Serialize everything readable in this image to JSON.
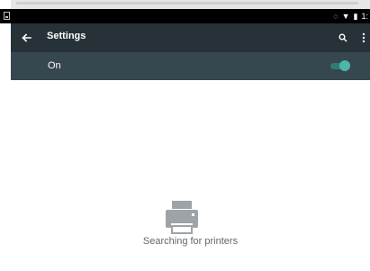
{
  "status_bar": {
    "time": "1:"
  },
  "app_bar": {
    "title": "Settings"
  },
  "switch_bar": {
    "label": "On",
    "enabled": true,
    "accent": "#4db6ac"
  },
  "empty_state": {
    "message": "Searching for printers",
    "icon": "printer-icon"
  },
  "colors": {
    "app_bar": "#263238",
    "switch_bar": "#37474f",
    "status_bar": "#000000"
  }
}
